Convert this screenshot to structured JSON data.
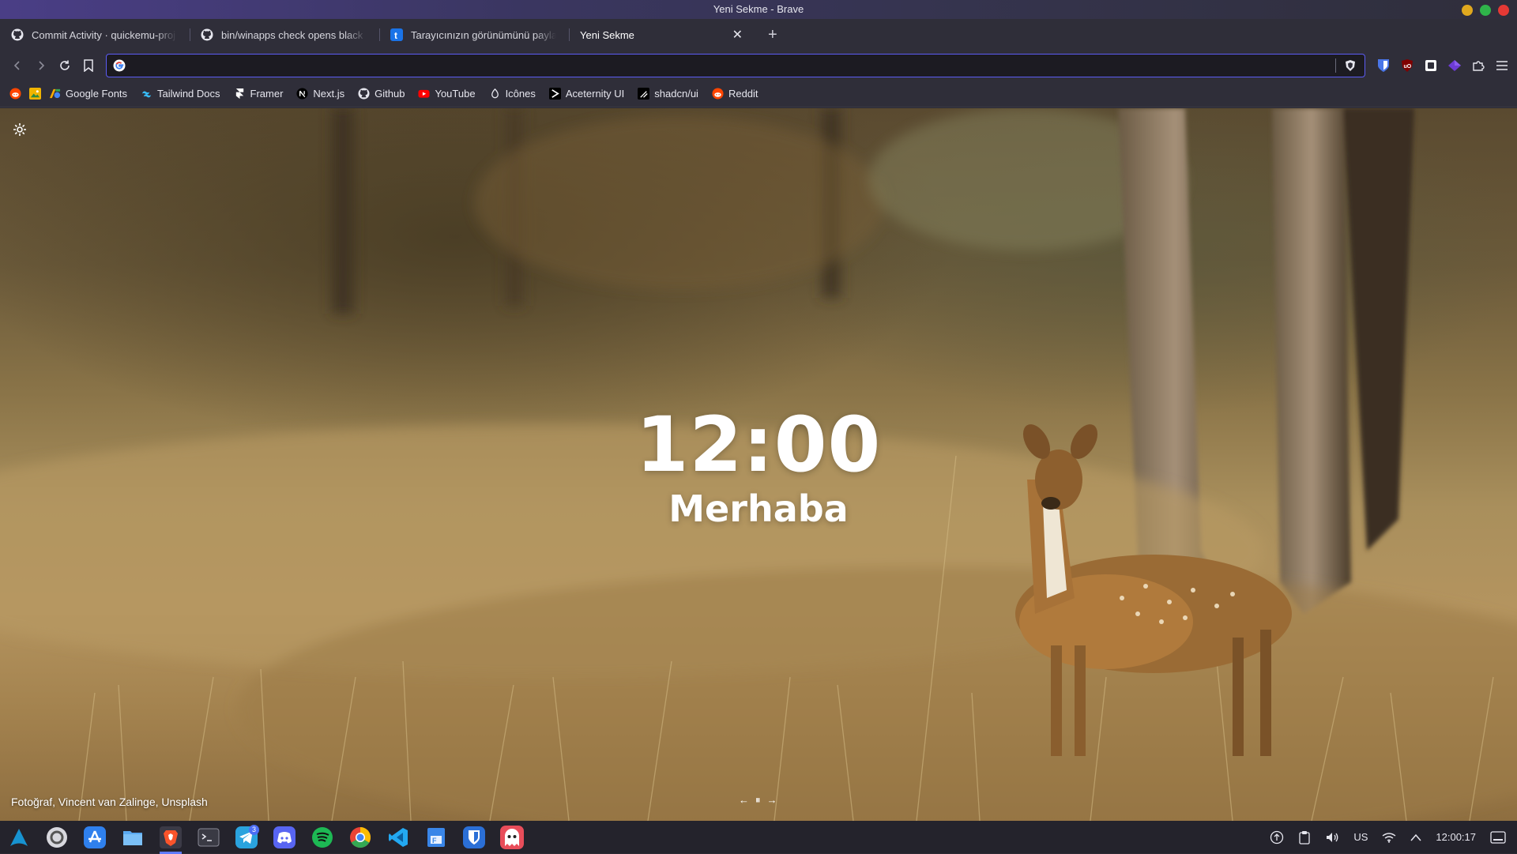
{
  "window": {
    "title": "Yeni Sekme - Brave",
    "buttons": [
      {
        "name": "minimize",
        "color": "#e0a81e"
      },
      {
        "name": "maximize",
        "color": "#2fb34a"
      },
      {
        "name": "close",
        "color": "#e53935"
      }
    ]
  },
  "tabs": [
    {
      "title": "Commit Activity · quickemu-proj",
      "icon": "github-icon"
    },
    {
      "title": "bin/winapps check opens black",
      "icon": "github-icon"
    },
    {
      "title": "Tarayıcınızın görünümünü paylaş",
      "icon": "tumblr-icon"
    },
    {
      "title": "Yeni Sekme",
      "icon": "",
      "active": true
    }
  ],
  "new_tab_label": "+",
  "tab_close_label": "✕",
  "address_bar": {
    "value": "",
    "placeholder": ""
  },
  "bookmarks": [
    {
      "label": "",
      "icon": "reddit-icon",
      "color": "#ff4500"
    },
    {
      "label": "",
      "icon": "image-icon",
      "color": "#f0b400"
    },
    {
      "label": "Google Fonts",
      "icon": "google-fonts-icon",
      "color": "#4285f4"
    },
    {
      "label": "Tailwind Docs",
      "icon": "tailwind-icon",
      "color": "#38bdf8"
    },
    {
      "label": "Framer",
      "icon": "framer-icon",
      "color": "#ffffff"
    },
    {
      "label": "Next.js",
      "icon": "nextjs-icon",
      "color": "#ffffff"
    },
    {
      "label": "Github",
      "icon": "github-icon",
      "color": "#ffffff"
    },
    {
      "label": "YouTube",
      "icon": "youtube-icon",
      "color": "#ff0000"
    },
    {
      "label": "Icônes",
      "icon": "iconify-icon",
      "color": "#ffffff"
    },
    {
      "label": "Aceternity UI",
      "icon": "aceternity-icon",
      "color": "#ffffff"
    },
    {
      "label": "shadcn/ui",
      "icon": "shadcn-icon",
      "color": "#ffffff"
    },
    {
      "label": "Reddit",
      "icon": "reddit-icon",
      "color": "#ff4500"
    }
  ],
  "newtab": {
    "clock": "12:00",
    "greeting": "Merhaba",
    "photo_credit": "Fotoğraf, Vincent van Zalinge, Unsplash",
    "photo_nav": {
      "prev": "←",
      "pause": "⏸",
      "next": "→"
    }
  },
  "extensions": [
    "bitwarden-icon",
    "ublock-icon",
    "extension-square-icon",
    "purple-gem-icon",
    "puzzle-icon",
    "menu-icon"
  ],
  "taskbar": {
    "apps": [
      {
        "name": "arch-launcher-icon",
        "color": "#1793d1"
      },
      {
        "name": "settings-app-icon",
        "color": "#d8d8de"
      },
      {
        "name": "app-store-icon",
        "color": "#2f80ed"
      },
      {
        "name": "files-icon",
        "color": "#5aa9f0"
      },
      {
        "name": "brave-icon",
        "color": "#fb542b",
        "active": true
      },
      {
        "name": "terminal-icon",
        "color": "#3a3a44"
      },
      {
        "name": "telegram-icon",
        "color": "#2aa3de",
        "badge": "3"
      },
      {
        "name": "discord-icon",
        "color": "#5865f2"
      },
      {
        "name": "spotify-icon",
        "color": "#1db954"
      },
      {
        "name": "chrome-icon",
        "color": "#ea4335"
      },
      {
        "name": "vscode-icon",
        "color": "#23a9f2"
      },
      {
        "name": "writer-icon",
        "color": "#3a86e8"
      },
      {
        "name": "bitwarden-app-icon",
        "color": "#2b6fd6"
      },
      {
        "name": "ghost-app-icon",
        "color": "#e84d5a"
      }
    ],
    "tray": {
      "keyboard_layout": "US",
      "time": "12:00:17"
    }
  }
}
